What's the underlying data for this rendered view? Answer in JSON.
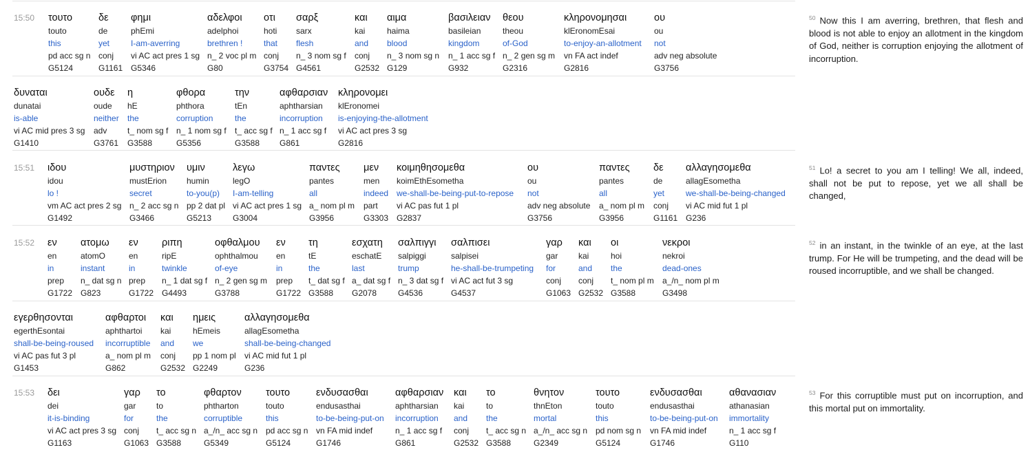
{
  "verses": [
    {
      "ref": "15:50",
      "rows": [
        [
          {
            "greek": "τουτο",
            "translit": "touto",
            "english": "this",
            "parse": "pd acc sg n",
            "strongs": "G5124"
          },
          {
            "greek": "δε",
            "translit": "de",
            "english": "yet",
            "parse": "conj",
            "strongs": "G1161"
          },
          {
            "greek": "φημι",
            "translit": "phEmi",
            "english": "I-am-averring",
            "parse": "vi AC act pres 1 sg",
            "strongs": "G5346"
          },
          {
            "greek": "αδελφοι",
            "translit": "adelphoi",
            "english": "brethren !",
            "parse": "n_ 2 voc pl m",
            "strongs": "G80"
          },
          {
            "greek": "οτι",
            "translit": "hoti",
            "english": "that",
            "parse": "conj",
            "strongs": "G3754"
          },
          {
            "greek": "σαρξ",
            "translit": "sarx",
            "english": "flesh",
            "parse": "n_ 3 nom sg f",
            "strongs": "G4561"
          },
          {
            "greek": "και",
            "translit": "kai",
            "english": "and",
            "parse": "conj",
            "strongs": "G2532"
          },
          {
            "greek": "αιμα",
            "translit": "haima",
            "english": "blood",
            "parse": "n_ 3 nom sg n",
            "strongs": "G129"
          },
          {
            "greek": "βασιλειαν",
            "translit": "basileian",
            "english": "kingdom",
            "parse": "n_ 1 acc sg f",
            "strongs": "G932"
          },
          {
            "greek": "θεου",
            "translit": "theou",
            "english": "of-God",
            "parse": "n_ 2 gen sg m",
            "strongs": "G2316"
          },
          {
            "greek": "κληρονομησαι",
            "translit": "klEronomEsai",
            "english": "to-enjoy-an-allotment",
            "parse": "vn FA act indef",
            "strongs": "G2816"
          },
          {
            "greek": "ου",
            "translit": "ou",
            "english": "not",
            "parse": "adv neg absolute",
            "strongs": "G3756"
          }
        ],
        [
          {
            "greek": "δυναται",
            "translit": "dunatai",
            "english": "is-able",
            "parse": "vi AC mid pres 3 sg",
            "strongs": "G1410"
          },
          {
            "greek": "ουδε",
            "translit": "oude",
            "english": "neither",
            "parse": "adv",
            "strongs": "G3761"
          },
          {
            "greek": "η",
            "translit": "hE",
            "english": "the",
            "parse": "t_ nom sg f",
            "strongs": "G3588"
          },
          {
            "greek": "φθορα",
            "translit": "phthora",
            "english": "corruption",
            "parse": "n_ 1 nom sg f",
            "strongs": "G5356"
          },
          {
            "greek": "την",
            "translit": "tEn",
            "english": "the",
            "parse": "t_ acc sg f",
            "strongs": "G3588"
          },
          {
            "greek": "αφθαρσιαν",
            "translit": "aphtharsian",
            "english": "incorruption",
            "parse": "n_ 1 acc sg f",
            "strongs": "G861"
          },
          {
            "greek": "κληρονομει",
            "translit": "klEronomei",
            "english": "is-enjoying-the-allotment",
            "parse": "vi AC act pres 3 sg",
            "strongs": "G2816"
          }
        ]
      ],
      "translation": "Now this I am averring, brethren, that flesh and blood is not able to enjoy an allotment in the kingdom of God, neither is corruption enjoying the allotment of incorruption."
    },
    {
      "ref": "15:51",
      "rows": [
        [
          {
            "greek": "ιδου",
            "translit": "idou",
            "english": "lo !",
            "parse": "vm AC act pres 2 sg",
            "strongs": "G1492"
          },
          {
            "greek": "μυστηριον",
            "translit": "mustErion",
            "english": "secret",
            "parse": "n_ 2 acc sg n",
            "strongs": "G3466"
          },
          {
            "greek": "υμιν",
            "translit": "humin",
            "english": "to-you(p)",
            "parse": "pp 2 dat pl",
            "strongs": "G5213"
          },
          {
            "greek": "λεγω",
            "translit": "legO",
            "english": "I-am-telling",
            "parse": "vi AC act pres 1 sg",
            "strongs": "G3004"
          },
          {
            "greek": "παντες",
            "translit": "pantes",
            "english": "all",
            "parse": "a_ nom pl m",
            "strongs": "G3956"
          },
          {
            "greek": "μεν",
            "translit": "men",
            "english": "indeed",
            "parse": "part",
            "strongs": "G3303"
          },
          {
            "greek": "κοιμηθησομεθα",
            "translit": "koimEthEsometha",
            "english": "we-shall-be-being-put-to-repose",
            "parse": "vi AC pas fut 1 pl",
            "strongs": "G2837"
          },
          {
            "greek": "ου",
            "translit": "ou",
            "english": "not",
            "parse": "adv neg absolute",
            "strongs": "G3756"
          },
          {
            "greek": "παντες",
            "translit": "pantes",
            "english": "all",
            "parse": "a_ nom pl m",
            "strongs": "G3956"
          },
          {
            "greek": "δε",
            "translit": "de",
            "english": "yet",
            "parse": "conj",
            "strongs": "G1161"
          },
          {
            "greek": "αλλαγησομεθα",
            "translit": "allagEsometha",
            "english": "we-shall-be-being-changed",
            "parse": "vi AC mid fut 1 pl",
            "strongs": "G236"
          }
        ]
      ],
      "translation": "Lo! a secret to you am I telling! We all, indeed, shall not be put to repose, yet we all shall be changed,"
    },
    {
      "ref": "15:52",
      "rows": [
        [
          {
            "greek": "εν",
            "translit": "en",
            "english": "in",
            "parse": "prep",
            "strongs": "G1722"
          },
          {
            "greek": "ατομω",
            "translit": "atomO",
            "english": "instant",
            "parse": "n_ dat sg n",
            "strongs": "G823"
          },
          {
            "greek": "εν",
            "translit": "en",
            "english": "in",
            "parse": "prep",
            "strongs": "G1722"
          },
          {
            "greek": "ριπη",
            "translit": "ripE",
            "english": "twinkle",
            "parse": "n_ 1 dat sg f",
            "strongs": "G4493"
          },
          {
            "greek": "οφθαλμου",
            "translit": "ophthalmou",
            "english": "of-eye",
            "parse": "n_ 2 gen sg m",
            "strongs": "G3788"
          },
          {
            "greek": "εν",
            "translit": "en",
            "english": "in",
            "parse": "prep",
            "strongs": "G1722"
          },
          {
            "greek": "τη",
            "translit": "tE",
            "english": "the",
            "parse": "t_ dat sg f",
            "strongs": "G3588"
          },
          {
            "greek": "εσχατη",
            "translit": "eschatE",
            "english": "last",
            "parse": "a_ dat sg f",
            "strongs": "G2078"
          },
          {
            "greek": "σαλπιγγι",
            "translit": "salpiggi",
            "english": "trump",
            "parse": "n_ 3 dat sg f",
            "strongs": "G4536"
          },
          {
            "greek": "σαλπισει",
            "translit": "salpisei",
            "english": "he-shall-be-trumpeting",
            "parse": "vi AC act fut 3 sg",
            "strongs": "G4537"
          },
          {
            "greek": "γαρ",
            "translit": "gar",
            "english": "for",
            "parse": "conj",
            "strongs": "G1063"
          },
          {
            "greek": "και",
            "translit": "kai",
            "english": "and",
            "parse": "conj",
            "strongs": "G2532"
          },
          {
            "greek": "οι",
            "translit": "hoi",
            "english": "the",
            "parse": "t_ nom pl m",
            "strongs": "G3588"
          },
          {
            "greek": "νεκροι",
            "translit": "nekroi",
            "english": "dead-ones",
            "parse": "a_/n_ nom pl m",
            "strongs": "G3498"
          }
        ],
        [
          {
            "greek": "εγερθησονται",
            "translit": "egerthEsontai",
            "english": "shall-be-being-roused",
            "parse": "vi AC pas fut 3 pl",
            "strongs": "G1453"
          },
          {
            "greek": "αφθαρτοι",
            "translit": "aphthartoi",
            "english": "incorruptible",
            "parse": "a_ nom pl m",
            "strongs": "G862"
          },
          {
            "greek": "και",
            "translit": "kai",
            "english": "and",
            "parse": "conj",
            "strongs": "G2532"
          },
          {
            "greek": "ημεις",
            "translit": "hEmeis",
            "english": "we",
            "parse": "pp 1 nom pl",
            "strongs": "G2249"
          },
          {
            "greek": "αλλαγησομεθα",
            "translit": "allagEsometha",
            "english": "shall-be-being-changed",
            "parse": "vi AC mid fut 1 pl",
            "strongs": "G236"
          }
        ]
      ],
      "translation": "in an instant, in the twinkle of an eye, at the last trump. For He will be trumpeting, and the dead will be roused incorruptible, and we shall be changed."
    },
    {
      "ref": "15:53",
      "rows": [
        [
          {
            "greek": "δει",
            "translit": "dei",
            "english": "it-is-binding",
            "parse": "vi AC act pres 3 sg",
            "strongs": "G1163"
          },
          {
            "greek": "γαρ",
            "translit": "gar",
            "english": "for",
            "parse": "conj",
            "strongs": "G1063"
          },
          {
            "greek": "το",
            "translit": "to",
            "english": "the",
            "parse": "t_ acc sg n",
            "strongs": "G3588"
          },
          {
            "greek": "φθαρτον",
            "translit": "phtharton",
            "english": "corruptible",
            "parse": "a_/n_ acc sg n",
            "strongs": "G5349"
          },
          {
            "greek": "τουτο",
            "translit": "touto",
            "english": "this",
            "parse": "pd acc sg n",
            "strongs": "G5124"
          },
          {
            "greek": "ενδυσασθαι",
            "translit": "endusasthai",
            "english": "to-be-being-put-on",
            "parse": "vn FA mid indef",
            "strongs": "G1746"
          },
          {
            "greek": "αφθαρσιαν",
            "translit": "aphtharsian",
            "english": "incorruption",
            "parse": "n_ 1 acc sg f",
            "strongs": "G861"
          },
          {
            "greek": "και",
            "translit": "kai",
            "english": "and",
            "parse": "conj",
            "strongs": "G2532"
          },
          {
            "greek": "το",
            "translit": "to",
            "english": "the",
            "parse": "t_ acc sg n",
            "strongs": "G3588"
          },
          {
            "greek": "θνητον",
            "translit": "thnEton",
            "english": "mortal",
            "parse": "a_/n_ acc sg n",
            "strongs": "G2349"
          },
          {
            "greek": "τουτο",
            "translit": "touto",
            "english": "this",
            "parse": "pd nom sg n",
            "strongs": "G5124"
          },
          {
            "greek": "ενδυσασθαι",
            "translit": "endusasthai",
            "english": "to-be-being-put-on",
            "parse": "vn FA mid indef",
            "strongs": "G1746"
          },
          {
            "greek": "αθανασιαν",
            "translit": "athanasian",
            "english": "immortality",
            "parse": "n_ 1 acc sg f",
            "strongs": "G110"
          }
        ]
      ],
      "translation": "For this corruptible must put on incorruption, and this mortal put on immortality."
    }
  ],
  "verse_numbers": [
    "50",
    "51",
    "52",
    "53"
  ],
  "colors": {
    "english": "#2a62c9",
    "divider": "#e3e3e3",
    "ref": "#9a9a9a"
  }
}
